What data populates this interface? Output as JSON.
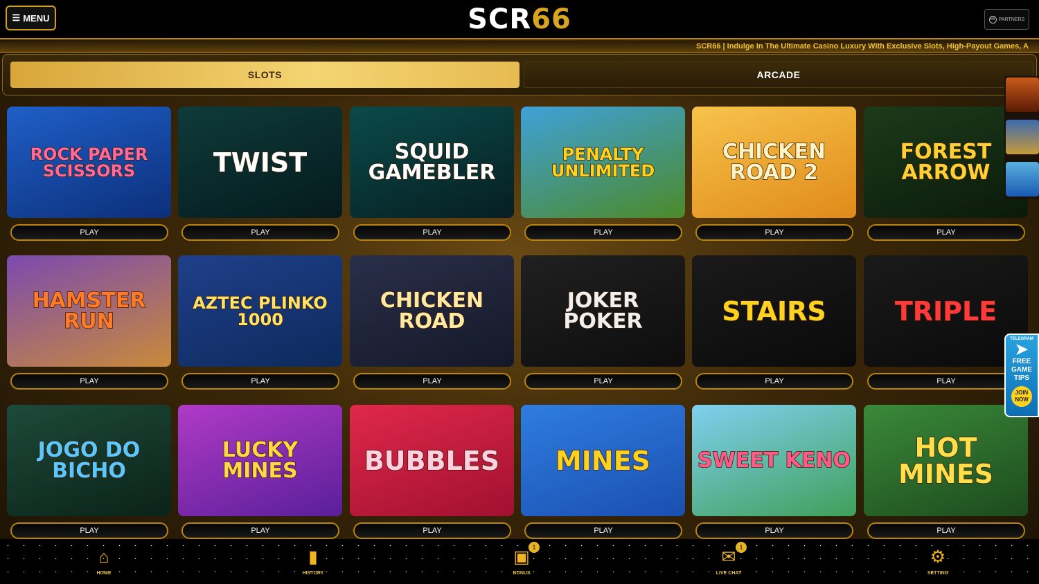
{
  "header": {
    "menu_label": "MENU",
    "logo_main": "SCR",
    "logo_accent": "66",
    "partners_label": "PARTNERS",
    "partners_badge": "66"
  },
  "marquee": {
    "text": "SCR66 | Indulge In The Ultimate Casino Luxury With Exclusive Slots, High-Payout Games, A"
  },
  "tabs": [
    {
      "label": "SLOTS",
      "active": true
    },
    {
      "label": "ARCADE",
      "active": false
    }
  ],
  "games": [
    {
      "name": "ROCK PAPER SCISSORS",
      "play": "PLAY",
      "bg": "#1f5fc8",
      "bg2": "#0c2f7a",
      "fg": "#ff6a9a"
    },
    {
      "name": "TWIST",
      "play": "PLAY",
      "bg": "#0e3b3a",
      "bg2": "#051a1c",
      "fg": "#ffffff"
    },
    {
      "name": "SQUID GAMEBLER",
      "play": "PLAY",
      "bg": "#0b4a4a",
      "bg2": "#061f22",
      "fg": "#ffffff"
    },
    {
      "name": "PENALTY UNLIMITED",
      "play": "PLAY",
      "bg": "#3fa1d9",
      "bg2": "#4c8a2a",
      "fg": "#ffd21f"
    },
    {
      "name": "CHICKEN ROAD 2",
      "play": "PLAY",
      "bg": "#f7c34a",
      "bg2": "#e08a1a",
      "fg": "#fff3c4"
    },
    {
      "name": "FOREST ARROW",
      "play": "PLAY",
      "bg": "#1c3b1a",
      "bg2": "#0a1a0a",
      "fg": "#ffcf33"
    },
    {
      "name": "HAMSTER RUN",
      "play": "PLAY",
      "bg": "#7b4ab0",
      "bg2": "#c98a3a",
      "fg": "#ff7b2a"
    },
    {
      "name": "AZTEC PLINKO 1000",
      "play": "PLAY",
      "bg": "#1f3f8a",
      "bg2": "#0d2a5c",
      "fg": "#ffe26b"
    },
    {
      "name": "CHICKEN ROAD",
      "play": "PLAY",
      "bg": "#2a2f4a",
      "bg2": "#141828",
      "fg": "#ffe9a3"
    },
    {
      "name": "JOKER POKER",
      "play": "PLAY",
      "bg": "#202020",
      "bg2": "#0d0d0d",
      "fg": "#f0f0f0"
    },
    {
      "name": "STAIRS",
      "play": "PLAY",
      "bg": "#1a1a1a",
      "bg2": "#0a0a0a",
      "fg": "#ffd21f"
    },
    {
      "name": "TRIPLE",
      "play": "PLAY",
      "bg": "#1a1a1a",
      "bg2": "#0a0a0a",
      "fg": "#ff3a3a"
    },
    {
      "name": "JOGO DO BICHO",
      "play": "PLAY",
      "bg": "#1d4a3a",
      "bg2": "#0b2219",
      "fg": "#5ac8ff"
    },
    {
      "name": "LUCKY MINES",
      "play": "PLAY",
      "bg": "#b03ac8",
      "bg2": "#5a1f9a",
      "fg": "#ffd84a"
    },
    {
      "name": "BUBBLES",
      "play": "PLAY",
      "bg": "#e0284a",
      "bg2": "#a11030",
      "fg": "#ffd0e0"
    },
    {
      "name": "MINES",
      "play": "PLAY",
      "bg": "#2f7de0",
      "bg2": "#1a4fb0",
      "fg": "#ffd21f"
    },
    {
      "name": "SWEET KENO",
      "play": "PLAY",
      "bg": "#7fd0f0",
      "bg2": "#3fa05a",
      "fg": "#ff5a8a"
    },
    {
      "name": "HOT MINES",
      "play": "PLAY",
      "bg": "#3a8a3a",
      "bg2": "#1d4a1d",
      "fg": "#ffe04a"
    }
  ],
  "telegram": {
    "label": "TELEGRAM",
    "line1": "FREE",
    "line2": "GAME",
    "line3": "TIPS",
    "join1": "JOIN",
    "join2": "NOW"
  },
  "bottom_nav": [
    {
      "label": "HOME",
      "icon": "home-icon",
      "badge": ""
    },
    {
      "label": "HISTORY",
      "icon": "history-icon",
      "badge": ""
    },
    {
      "label": "BONUS",
      "icon": "gift-icon",
      "badge": "1"
    },
    {
      "label": "LIVE CHAT",
      "icon": "chat-icon",
      "badge": "1"
    },
    {
      "label": "SETTING",
      "icon": "gear-icon",
      "badge": ""
    }
  ]
}
